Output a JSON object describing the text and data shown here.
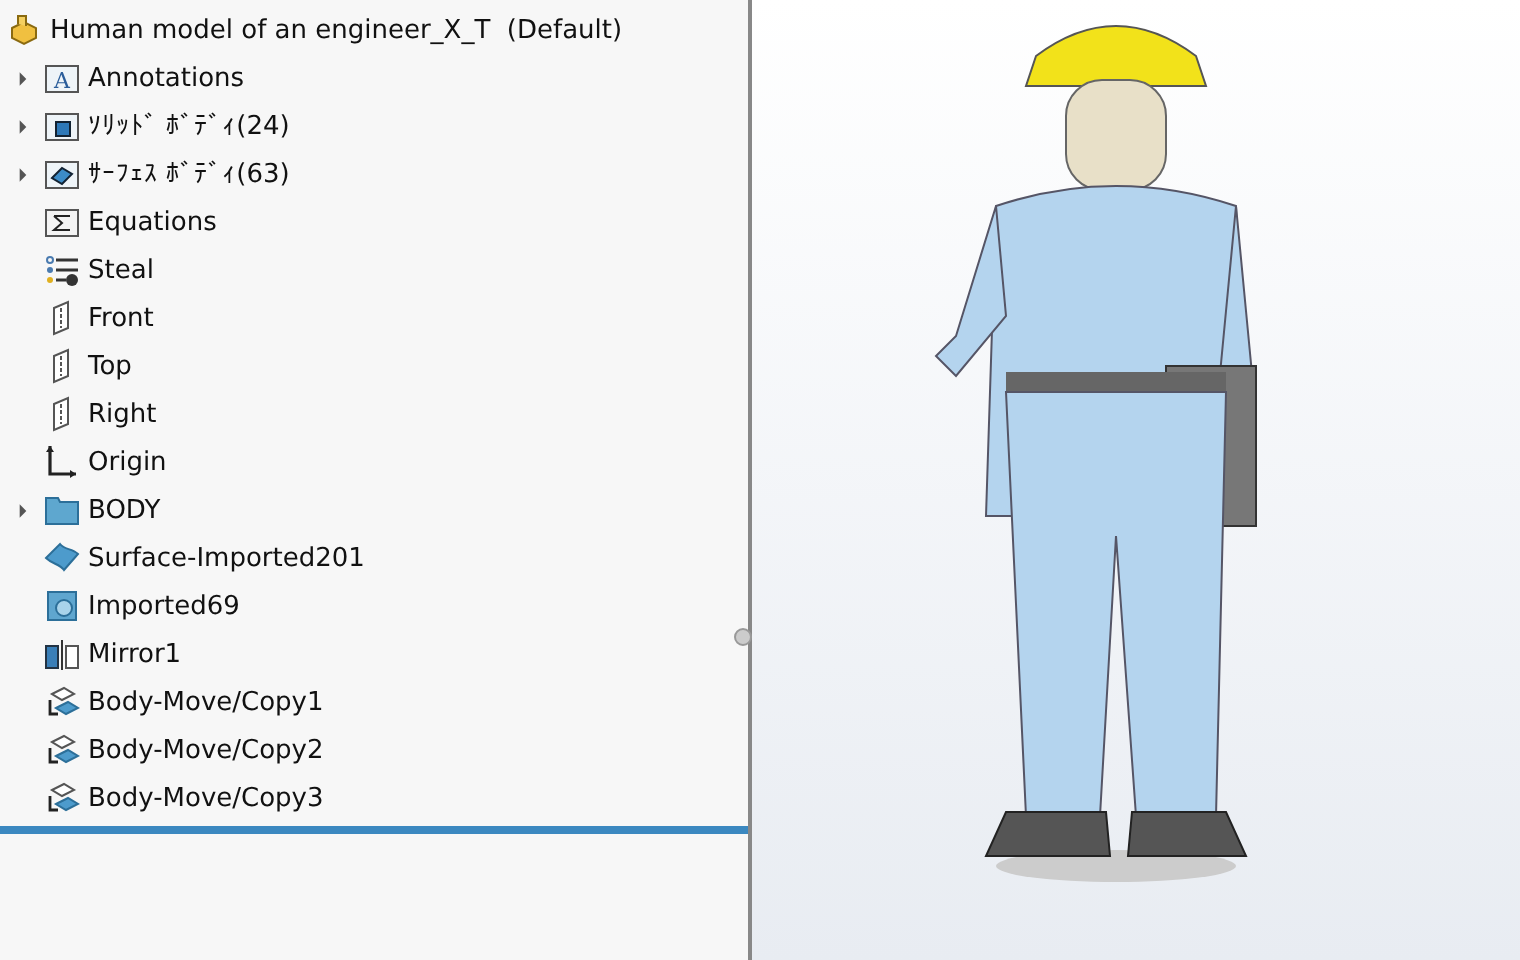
{
  "tree": {
    "root": {
      "label": "Human model of an engineer_X_T  (Default)",
      "kind": "part"
    },
    "items": [
      {
        "label": "Annotations",
        "kind": "annotations",
        "glyph": "A",
        "expandable": true
      },
      {
        "label": "ｿﾘｯﾄﾞ ﾎﾞﾃﾞｨ(24)",
        "kind": "solid-folder",
        "expandable": true
      },
      {
        "label": "ｻｰﾌｪｽ ﾎﾞﾃﾞｨ(63)",
        "kind": "surface-folder",
        "expandable": true
      },
      {
        "label": "Equations",
        "kind": "equations",
        "expandable": false
      },
      {
        "label": "Steal",
        "kind": "material",
        "expandable": false
      },
      {
        "label": "Front",
        "kind": "plane",
        "expandable": false
      },
      {
        "label": "Top",
        "kind": "plane",
        "expandable": false
      },
      {
        "label": "Right",
        "kind": "plane",
        "expandable": false
      },
      {
        "label": "Origin",
        "kind": "origin",
        "expandable": false
      },
      {
        "label": "BODY",
        "kind": "folder",
        "expandable": true
      },
      {
        "label": "Surface-Imported201",
        "kind": "surface",
        "expandable": false
      },
      {
        "label": "Imported69",
        "kind": "solid",
        "expandable": false
      },
      {
        "label": "Mirror1",
        "kind": "mirror",
        "expandable": false
      },
      {
        "label": "Body-Move/Copy1",
        "kind": "move",
        "expandable": false
      },
      {
        "label": "Body-Move/Copy2",
        "kind": "move",
        "expandable": false
      },
      {
        "label": "Body-Move/Copy3",
        "kind": "move",
        "expandable": false
      }
    ]
  }
}
